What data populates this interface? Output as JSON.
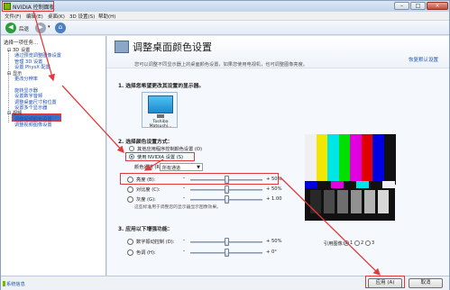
{
  "window": {
    "title": "NVIDIA 控制面板",
    "buttons": {
      "minimize": "–",
      "maximize": "□",
      "close": "×"
    }
  },
  "menubar": [
    "文件(F)",
    "编辑(E)",
    "桌面(K)",
    "3D 设置(S)",
    "帮助(H)"
  ],
  "toolbar": {
    "back_label": "后退",
    "forward_icon": "forward-arrow-icon",
    "home_icon": "home-icon"
  },
  "sidebar": {
    "title": "选择一项任务...",
    "items": [
      {
        "text": "3D 设置",
        "kind": "cat"
      },
      {
        "text": "通过预览调整图像设置",
        "kind": "link"
      },
      {
        "text": "管理 3D 设置",
        "kind": "link"
      },
      {
        "text": "设置 PhysX 配置",
        "kind": "link"
      },
      {
        "text": "显示",
        "kind": "cat"
      },
      {
        "text": "更改分辨率",
        "kind": "link"
      },
      {
        "text": "调整桌面颜色设置",
        "kind": "link"
      },
      {
        "text": "旋转显示器",
        "kind": "link"
      },
      {
        "text": "设置数字音频",
        "kind": "link"
      },
      {
        "text": "调整桌面尺寸和位置",
        "kind": "link"
      },
      {
        "text": "设置多个显示器",
        "kind": "link"
      },
      {
        "text": "视频",
        "kind": "cat"
      },
      {
        "text": "调整视频颜色设置",
        "kind": "link"
      },
      {
        "text": "调整视频图像设置",
        "kind": "link"
      }
    ]
  },
  "content": {
    "title": "调整桌面颜色设置",
    "restore_link": "恢复默认设置",
    "description": "您可以调整不同显示器上的桌面颜色设置，如果您使用电视机，也可调整图像亮度。",
    "section1": "1.  选择您希望更改其设置的显示器。",
    "monitor_name": "Toshiba Matsushi...",
    "section2": "2.  选择颜色设置方式：",
    "option_other": "其他应用程序控制颜色设置 (O)",
    "option_nvidia": "使用 NVIDIA 设置 (S)",
    "channel_label": "颜色通道 (R):",
    "channel_value": "所有通道",
    "sliders": [
      {
        "label": "亮度 (B):",
        "value": "+ 50%",
        "level": 0.5
      },
      {
        "label": "对比度 (C):",
        "value": "+ 50%",
        "level": 0.5
      },
      {
        "label": "灰度 (G):",
        "value": "+ 1.00",
        "level": 0.5
      }
    ],
    "slider_note": "这些标准用于调整您的显示器显示图像效果。",
    "section3": "3.  应用以下增强功能：",
    "enhance_sliders": [
      {
        "label": "数字振动控制 (D):",
        "value": "+ 50%",
        "level": 0.5
      },
      {
        "label": "色调 (H):",
        "value": "+ 0°",
        "level": 0.5
      }
    ],
    "reference_label": "引用图像：",
    "reference_options": [
      "1",
      "2",
      "3"
    ],
    "reference_selected": "1",
    "pattern_colors": [
      "#f0f0f0",
      "#f3e600",
      "#00e6e6",
      "#00e000",
      "#e000e0",
      "#e00000",
      "#0000e0",
      "#111111"
    ]
  },
  "statusbar": {
    "system_info": "系统信息",
    "apply": "应用 (A)",
    "cancel": "取消"
  },
  "annotation_color": "#e23a3a"
}
